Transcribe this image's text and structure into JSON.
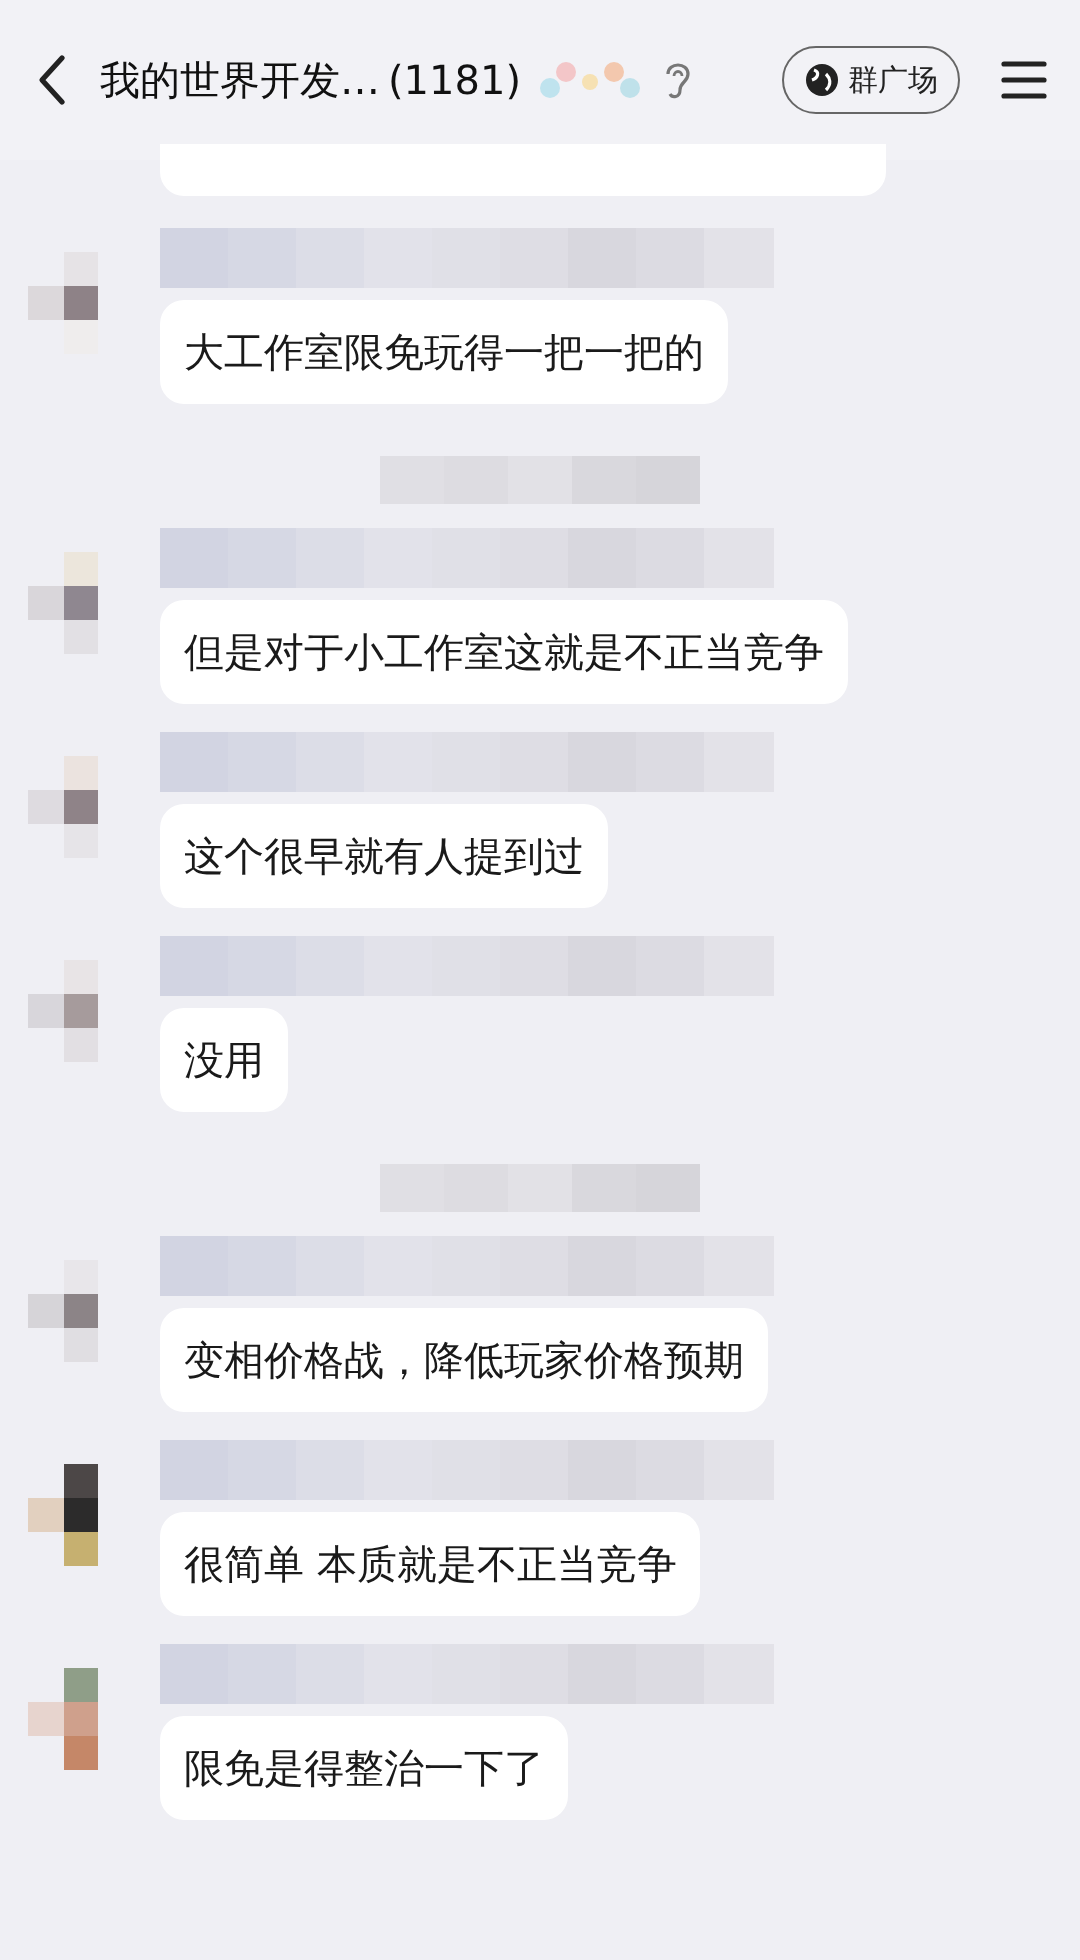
{
  "header": {
    "title": "我的世界开发…",
    "count": "(1181)",
    "square_button": "群广场"
  },
  "messages": [
    {
      "kind": "partial"
    },
    {
      "kind": "message",
      "text": "大工作室限免玩得一把一把的"
    },
    {
      "kind": "notice"
    },
    {
      "kind": "message",
      "text": "但是对于小工作室这就是不正当竞争"
    },
    {
      "kind": "message",
      "text": "这个很早就有人提到过"
    },
    {
      "kind": "message",
      "text": "没用"
    },
    {
      "kind": "notice"
    },
    {
      "kind": "message",
      "text": "变相价格战，降低玩家价格预期"
    },
    {
      "kind": "message",
      "text": "很简单 本质就是不正当竞争"
    },
    {
      "kind": "message",
      "text": "限免是得整治一下了"
    }
  ]
}
